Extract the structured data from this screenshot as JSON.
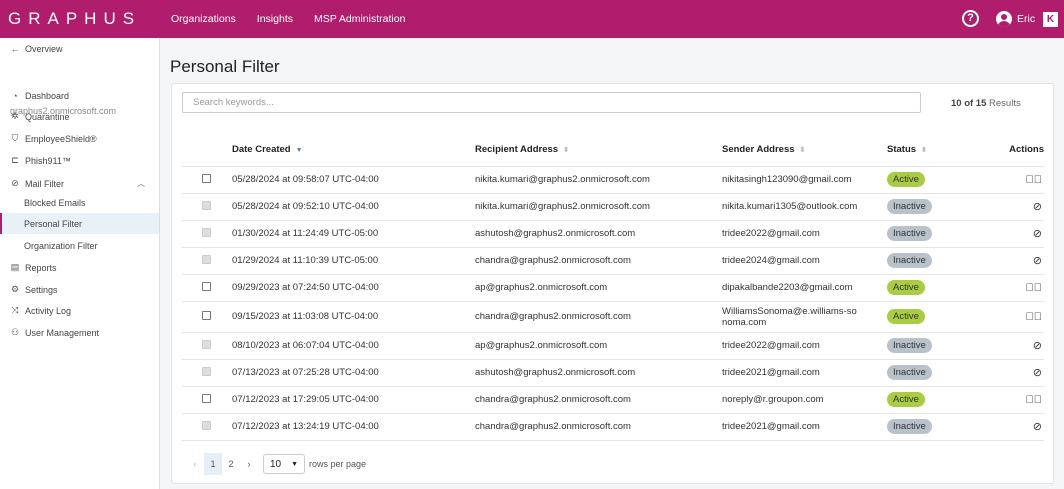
{
  "header": {
    "logo": "GRAPHUS",
    "nav": [
      "Organizations",
      "Insights",
      "MSP Administration"
    ],
    "user": "Eric",
    "help_icon": "?",
    "brand_badge": "K"
  },
  "sidebar": {
    "back": "Overview",
    "org": "graphus2.onmicrosoft.com",
    "items": [
      {
        "label": "Dashboard",
        "icon": "gauge-icon"
      },
      {
        "label": "Quarantine",
        "icon": "virus-icon"
      },
      {
        "label": "EmployeeShield®",
        "icon": "shield-icon"
      },
      {
        "label": "Phish911™",
        "icon": "megaphone-icon"
      },
      {
        "label": "Mail Filter",
        "icon": "block-icon"
      },
      {
        "label": "Blocked Emails"
      },
      {
        "label": "Personal Filter"
      },
      {
        "label": "Organization Filter"
      },
      {
        "label": "Reports",
        "icon": "report-icon"
      },
      {
        "label": "Settings",
        "icon": "gear-icon"
      },
      {
        "label": "Activity Log",
        "icon": "shuffle-icon"
      },
      {
        "label": "User Management",
        "icon": "user-icon"
      }
    ]
  },
  "page": {
    "title": "Personal Filter",
    "search_placeholder": "Search keywords...",
    "results_count": "10 of 15",
    "results_label": "Results"
  },
  "table": {
    "headers": [
      "Date Created",
      "Recipient Address",
      "Sender Address",
      "Status",
      "Actions"
    ],
    "rows": [
      {
        "date": "05/28/2024 at 09:58:07 UTC-04:00",
        "recipient": "nikita.kumari@graphus2.onmicrosoft.com",
        "sender": "nikitasingh123090@gmail.com",
        "status": "Active"
      },
      {
        "date": "05/28/2024 at 09:52:10 UTC-04:00",
        "recipient": "nikita.kumari@graphus2.onmicrosoft.com",
        "sender": "nikita.kumari1305@outlook.com",
        "status": "Inactive"
      },
      {
        "date": "01/30/2024 at 11:24:49 UTC-05:00",
        "recipient": "ashutosh@graphus2.onmicrosoft.com",
        "sender": "tridee2022@gmail.com",
        "status": "Inactive"
      },
      {
        "date": "01/29/2024 at 11:10:39 UTC-05:00",
        "recipient": "chandra@graphus2.onmicrosoft.com",
        "sender": "tridee2024@gmail.com",
        "status": "Inactive"
      },
      {
        "date": "09/29/2023 at 07:24:50 UTC-04:00",
        "recipient": "ap@graphus2.onmicrosoft.com",
        "sender": "dipakalbande2203@gmail.com",
        "status": "Active"
      },
      {
        "date": "09/15/2023 at 11:03:08 UTC-04:00",
        "recipient": "chandra@graphus2.onmicrosoft.com",
        "sender": "WilliamsSonoma@e.williams-sonoma.com",
        "status": "Active"
      },
      {
        "date": "08/10/2023 at 06:07:04 UTC-04:00",
        "recipient": "ap@graphus2.onmicrosoft.com",
        "sender": "tridee2022@gmail.com",
        "status": "Inactive"
      },
      {
        "date": "07/13/2023 at 07:25:28 UTC-04:00",
        "recipient": "ashutosh@graphus2.onmicrosoft.com",
        "sender": "tridee2021@gmail.com",
        "status": "Inactive"
      },
      {
        "date": "07/12/2023 at 17:29:05 UTC-04:00",
        "recipient": "chandra@graphus2.onmicrosoft.com",
        "sender": "noreply@r.groupon.com",
        "status": "Active"
      },
      {
        "date": "07/12/2023 at 13:24:19 UTC-04:00",
        "recipient": "chandra@graphus2.onmicrosoft.com",
        "sender": "tridee2021@gmail.com",
        "status": "Inactive"
      }
    ]
  },
  "pagination": {
    "pages": [
      "1",
      "2"
    ],
    "current": "1",
    "rows_per_page": "10",
    "rows_label": "rows per page"
  },
  "colors": {
    "brand": "#b01d6c",
    "active": "#a8cc43",
    "inactive": "#b7c2cb"
  }
}
